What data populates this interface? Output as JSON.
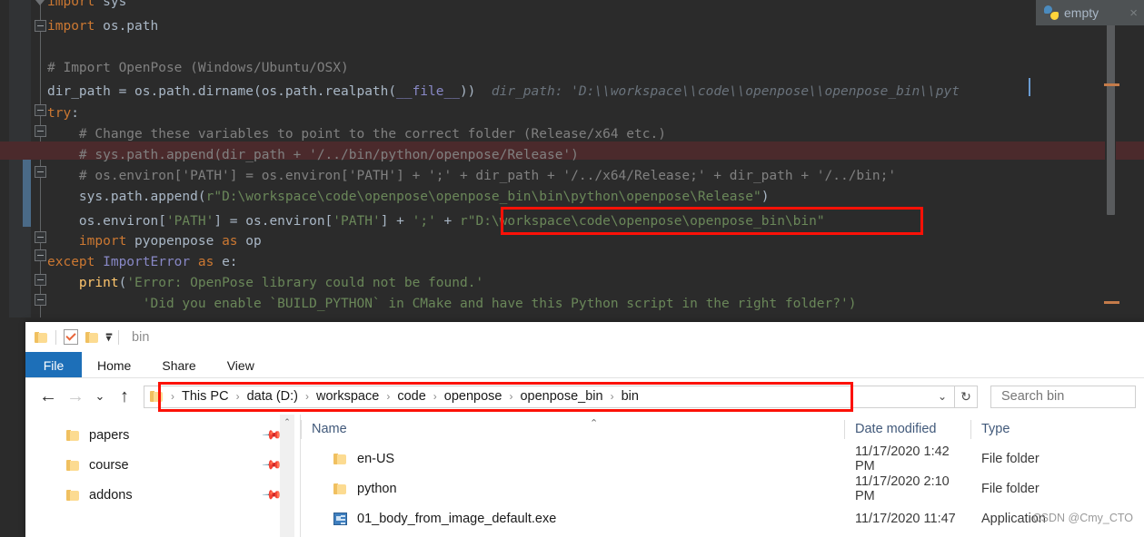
{
  "ide": {
    "tab": {
      "label": "empty",
      "close": "×",
      "icon": "python-file-icon"
    },
    "code_lines": [
      {
        "indent": 0,
        "segments": [
          {
            "t": "import ",
            "c": "kw"
          },
          {
            "t": "sys",
            "c": ""
          }
        ]
      },
      {
        "indent": 0,
        "segments": [
          {
            "t": "import ",
            "c": "kw"
          },
          {
            "t": "os.path",
            "c": ""
          }
        ]
      },
      {
        "indent": 0,
        "segments": []
      },
      {
        "indent": 0,
        "segments": [
          {
            "t": "# Import OpenPose (Windows/Ubuntu/OSX)",
            "c": "cm"
          }
        ]
      },
      {
        "indent": 0,
        "segments": [
          {
            "t": "dir_path = os.path.dirname(os.path.realpath(",
            "c": ""
          },
          {
            "t": "__file__",
            "c": "builtin"
          },
          {
            "t": "))",
            "c": ""
          },
          {
            "t": "  dir_path: 'D:\\\\workspace\\\\code\\\\openpose\\\\openpose_bin\\\\pyt",
            "c": "hint"
          }
        ]
      },
      {
        "indent": 0,
        "segments": [
          {
            "t": "try",
            "c": "kw"
          },
          {
            "t": ":",
            "c": ""
          }
        ]
      },
      {
        "indent": 1,
        "segments": [
          {
            "t": "# Change these variables to point to the correct folder (Release/x64 etc.)",
            "c": "cm"
          }
        ]
      },
      {
        "indent": 1,
        "segments": [
          {
            "t": "# sys.path.append(dir_path + '/../bin/python/openpose/Release')",
            "c": "cm"
          }
        ]
      },
      {
        "indent": 1,
        "segments": [
          {
            "t": "# os.environ['PATH'] = os.environ['PATH'] + ';' + dir_path + '/../x64/Release;' + dir_path + '/../bin;'",
            "c": "cm"
          }
        ]
      },
      {
        "indent": 1,
        "segments": [
          {
            "t": "sys.path.append(",
            "c": ""
          },
          {
            "t": "r\"D:\\workspace\\code\\openpose\\openpose_bin\\bin\\python\\openpose\\Release\"",
            "c": "str"
          },
          {
            "t": ")",
            "c": ""
          }
        ]
      },
      {
        "indent": 1,
        "segments": [
          {
            "t": "os.environ[",
            "c": ""
          },
          {
            "t": "'PATH'",
            "c": "str"
          },
          {
            "t": "] = os.environ[",
            "c": ""
          },
          {
            "t": "'PATH'",
            "c": "str"
          },
          {
            "t": "] + ",
            "c": ""
          },
          {
            "t": "';'",
            "c": "str"
          },
          {
            "t": " + ",
            "c": ""
          },
          {
            "t": "r\"D:\\workspace\\code\\openpose\\openpose_bin\\bin\"",
            "c": "str"
          }
        ]
      },
      {
        "indent": 1,
        "segments": [
          {
            "t": "import ",
            "c": "kw"
          },
          {
            "t": "pyopenpose ",
            "c": ""
          },
          {
            "t": "as ",
            "c": "kw"
          },
          {
            "t": "op",
            "c": ""
          }
        ]
      },
      {
        "indent": 0,
        "segments": [
          {
            "t": "except ",
            "c": "kw"
          },
          {
            "t": "ImportError ",
            "c": "builtin"
          },
          {
            "t": "as ",
            "c": "kw"
          },
          {
            "t": "e:",
            "c": ""
          }
        ]
      },
      {
        "indent": 1,
        "segments": [
          {
            "t": "print",
            "c": "fn"
          },
          {
            "t": "(",
            "c": ""
          },
          {
            "t": "'Error: OpenPose library could not be found.'",
            "c": "str"
          }
        ]
      },
      {
        "indent": 2,
        "segments": [
          {
            "t": "    'Did you enable `BUILD_PYTHON` in CMake and have this Python script in the right folder?')",
            "c": "str"
          }
        ]
      }
    ],
    "annotation_color": "#fc1107",
    "breakpoint_color": "#db5860"
  },
  "explorer": {
    "quick_access": {
      "title": "bin",
      "icons": [
        "folder-icon",
        "properties-icon",
        "new-folder-icon",
        "customize-caret-icon"
      ]
    },
    "ribbon_tabs": [
      {
        "label": "File",
        "active": true
      },
      {
        "label": "Home",
        "active": false
      },
      {
        "label": "Share",
        "active": false
      },
      {
        "label": "View",
        "active": false
      }
    ],
    "address": {
      "back": "←",
      "forward": "→",
      "recent": "⌄",
      "up": "↑",
      "crumbs": [
        "This PC",
        "data (D:)",
        "workspace",
        "code",
        "openpose",
        "openpose_bin",
        "bin"
      ],
      "separator": "›",
      "dropdown": "⌄",
      "refresh": "↻"
    },
    "search": {
      "placeholder": "Search bin"
    },
    "nav_pane": {
      "items": [
        {
          "label": "papers",
          "pinned": true
        },
        {
          "label": "course",
          "pinned": true
        },
        {
          "label": "addons",
          "pinned": true
        }
      ],
      "scroll_up": "⌃"
    },
    "list": {
      "columns": [
        "Name",
        "Date modified",
        "Type"
      ],
      "sort_indicator": "⌃",
      "rows": [
        {
          "name": "en-US",
          "date": "11/17/2020 1:42 PM",
          "type": "File folder",
          "icon": "folder-icon"
        },
        {
          "name": "python",
          "date": "11/17/2020 2:10 PM",
          "type": "File folder",
          "icon": "folder-icon"
        },
        {
          "name": "01_body_from_image_default.exe",
          "date": "11/17/2020 11:47",
          "type": "Application",
          "icon": "exe-icon"
        }
      ]
    },
    "accent_color": "#1d6fb8"
  },
  "watermark": "CSDN @Cmy_CTO"
}
